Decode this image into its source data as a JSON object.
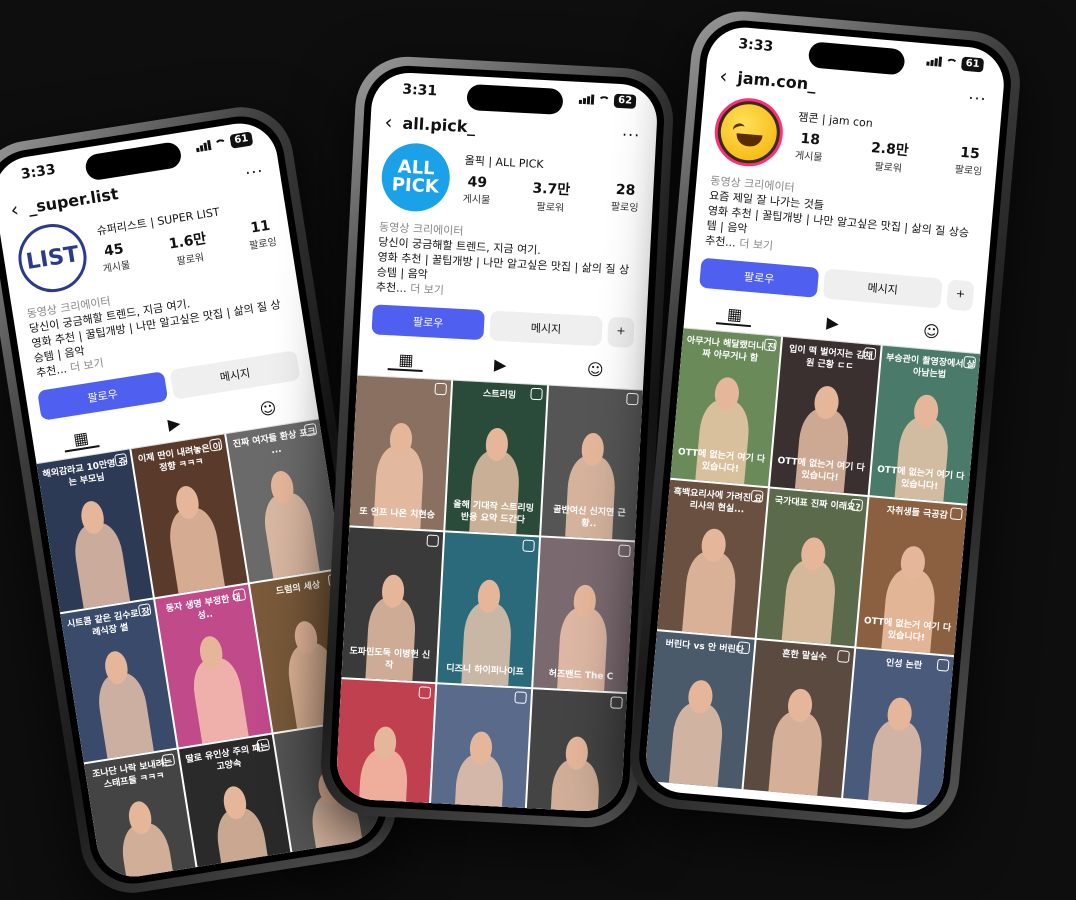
{
  "colors": {
    "background": "#0e0e0e",
    "follow_button": "#4f5ff0",
    "screen": "#ffffff"
  },
  "phones": [
    {
      "time": "3:33",
      "battery": "61",
      "handle": "_super.list",
      "avatar_text": "LIST",
      "display_name": "슈퍼리스트 | SUPER LIST",
      "posts": "45",
      "posts_label": "게시물",
      "followers": "1.6만",
      "followers_label": "팔로워",
      "following": "11",
      "following_label": "팔로잉",
      "category": "동영상 크리에이터",
      "bio1": "당신이 궁금해할 트렌드, 지금 여기.",
      "bio2": "영화 추천 | 꿀팁개방 | 나만 알고싶은 맛집 | 삶의 질 상승템 | 음악",
      "bio3": "추천...",
      "more": "더 보기",
      "follow": "팔로우",
      "message": "메시지",
      "tiles": [
        {
          "top": "해외감라교 10만명 쥬는 부모님",
          "bottom": "",
          "bg": "#2d3a55"
        },
        {
          "top": "이제 딴이 내려놓은 이정향 ㅋㅋㅋ",
          "bottom": "",
          "bg": "#5a3a2a"
        },
        {
          "top": "진짜 여자들 환상 포크 ...",
          "bottom": "",
          "bg": "#6a6a6a"
        },
        {
          "top": "시트콤 같은 김수로 장례식장 썰",
          "bottom": "",
          "bg": "#3a4a6a"
        },
        {
          "top": "둥자 생명 부정한 대성..",
          "bottom": "",
          "bg": "#c04a8a"
        },
        {
          "top": "드럼의 세상",
          "bottom": "",
          "bg": "#7a5a3a"
        },
        {
          "top": "조나단 나락 보내려는 스태프들 ㅋㅋㅋ",
          "bottom": "",
          "bg": "#444"
        },
        {
          "top": "딸로 유인상 주의 패는 고양속",
          "bottom": "",
          "bg": "#2a2a2a"
        },
        {
          "top": "",
          "bottom": "",
          "bg": "#555"
        }
      ]
    },
    {
      "time": "3:31",
      "battery": "62",
      "handle": "all.pick_",
      "avatar_text": "ALL PICK",
      "display_name": "올픽 | ALL PICK",
      "posts": "49",
      "posts_label": "게시물",
      "followers": "3.7만",
      "followers_label": "팔로워",
      "following": "28",
      "following_label": "팔로잉",
      "category": "동영상 크리에이터",
      "bio1": "당신이 궁금해할 트렌드, 지금 여기.",
      "bio2": "영화 추천 | 꿀팁개방 | 나만 알고싶은 맛집 | 삶의 질 상승템 | 음악",
      "bio3": "추천...",
      "more": "더 보기",
      "follow": "팔로우",
      "message": "메시지",
      "tiles": [
        {
          "top": "",
          "bottom": "또 언프 나온 치현승",
          "bg": "#8a7060"
        },
        {
          "top": "스트리밍",
          "bottom": "올해 기대작 스트리밍 반응 요약 드간다",
          "bg": "#2a4a3a"
        },
        {
          "top": "",
          "bottom": "골반여신 신지연 근황..",
          "bg": "#555"
        },
        {
          "top": "",
          "bottom": "도파민도둑 이병헌 신작",
          "bg": "#3a3a3a"
        },
        {
          "top": "",
          "bottom": "디즈니 하이퍼나이프",
          "bg": "#2a6a7a"
        },
        {
          "top": "",
          "bottom": "허즈밴드 The C",
          "bg": "#7a6a70"
        },
        {
          "top": "",
          "bottom": "",
          "bg": "#c04050"
        },
        {
          "top": "",
          "bottom": "",
          "bg": "#5a6a8a"
        },
        {
          "top": "",
          "bottom": "",
          "bg": "#444"
        }
      ]
    },
    {
      "time": "3:33",
      "battery": "61",
      "handle": "jam.con_",
      "avatar_text": "",
      "display_name": "잼콘 | jam con",
      "posts": "18",
      "posts_label": "게시물",
      "followers": "2.8만",
      "followers_label": "팔로워",
      "following": "15",
      "following_label": "팔로잉",
      "category": "동영상 크리에이터",
      "bio1": "요즘 제일 잘 나가는 것들",
      "bio2": "영화 추천 | 꿀팁개방 | 나만 알고싶은 맛집 | 삶의 질 상승템 | 음악",
      "bio3": "추천...",
      "more": "더 보기",
      "follow": "팔로우",
      "message": "메시지",
      "tiles": [
        {
          "top": "아무거나 해달랬더니 진짜 아무거나 함",
          "bottom": "OTT에 없는거 여기 다 있습니다!",
          "bg": "#6a8a5a"
        },
        {
          "top": "입이 떡 벌어지는 김채원 근황 ㄷㄷ",
          "bottom": "OTT에 없는거 여기 다 있습니다!",
          "bg": "#3a3030"
        },
        {
          "top": "부승관이 촬영장에서 살아남는법",
          "bottom": "OTT에 없는거 여기 다 있습니다!",
          "bg": "#4a7a6a"
        },
        {
          "top": "흑백요리사에 가려진 요리사의 현실...",
          "bottom": "",
          "bg": "#6a5040"
        },
        {
          "top": "국가대표 진짜 이래요?",
          "bottom": "",
          "bg": "#5a6a4a"
        },
        {
          "top": "자취생들 극공감",
          "bottom": "OTT에 없는거 여기 다 있습니다!",
          "bg": "#8a6040"
        },
        {
          "top": "버린다 vs 안 버린다",
          "bottom": "",
          "bg": "#4a5a6a"
        },
        {
          "top": "흔한 말실수",
          "bottom": "",
          "bg": "#5a4a40"
        },
        {
          "top": "인성 논란",
          "bottom": "",
          "bg": "#4a5a7a"
        }
      ]
    }
  ]
}
